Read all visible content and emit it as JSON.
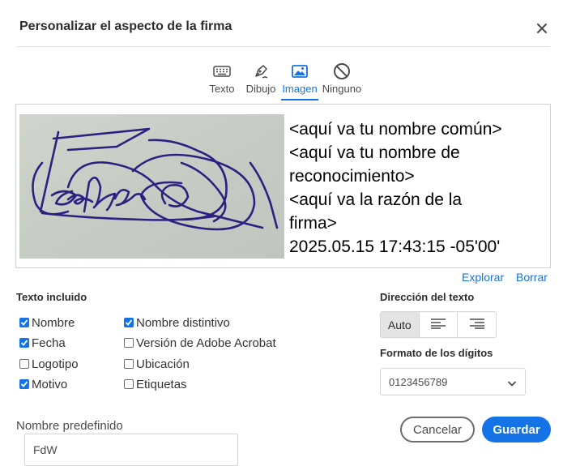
{
  "dialog": {
    "title": "Personalizar el aspecto de la firma"
  },
  "tabs": [
    {
      "label": "Texto",
      "icon": "keyboard-icon",
      "active": false
    },
    {
      "label": "Dibujo",
      "icon": "pen-icon",
      "active": false
    },
    {
      "label": "Imagen",
      "icon": "image-icon",
      "active": true
    },
    {
      "label": "Ninguno",
      "icon": "none-icon",
      "active": false
    }
  ],
  "preview": {
    "lines": [
      "<aquí va tu nombre común>",
      "<aquí va tu nombre de",
      "reconocimiento>",
      "<aquí va la razón de la",
      "firma>",
      "2025.05.15 17:43:15 -05'00'"
    ]
  },
  "links": {
    "browse": "Explorar",
    "clear": "Borrar"
  },
  "included_text": {
    "title": "Texto incluido",
    "options": [
      {
        "label": "Nombre",
        "checked": true
      },
      {
        "label": "Fecha",
        "checked": true
      },
      {
        "label": "Logotipo",
        "checked": false
      },
      {
        "label": "Motivo",
        "checked": true
      },
      {
        "label": "Nombre distintivo",
        "checked": true
      },
      {
        "label": "Versión de Adobe Acrobat",
        "checked": false
      },
      {
        "label": "Ubicación",
        "checked": false
      },
      {
        "label": "Etiquetas",
        "checked": false
      }
    ]
  },
  "text_direction": {
    "title": "Dirección del texto",
    "options": [
      "Auto",
      "align-left-icon",
      "align-right-icon"
    ],
    "selected": "Auto"
  },
  "digit_format": {
    "title": "Formato de los dígitos",
    "value": "0123456789"
  },
  "predefined_name": {
    "label": "Nombre predefinido",
    "value": "FdW"
  },
  "buttons": {
    "cancel": "Cancelar",
    "save": "Guardar"
  },
  "colors": {
    "accent": "#1473e6",
    "ink": "#2a2180",
    "paper": "#c8cfc7"
  }
}
